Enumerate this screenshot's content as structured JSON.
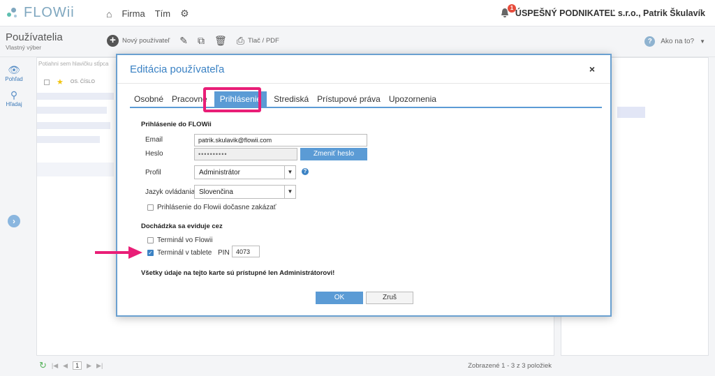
{
  "app": {
    "logo_text": "FLOWii"
  },
  "topnav": {
    "firma": "Firma",
    "tim": "Tím"
  },
  "company": {
    "name": "ÚSPEŠNÝ PODNIKATEĽ s.r.o., Patrik Škulavík",
    "notifications": "1"
  },
  "page": {
    "title": "Používatelia",
    "subtitle": "Vlastný výber"
  },
  "toolbar": {
    "new_user": "Nový používateľ",
    "print": "Tlač / PDF"
  },
  "help": {
    "label": "Ako na to?"
  },
  "sidebar": {
    "view": "Pohľad",
    "search": "Hľadaj"
  },
  "grid": {
    "group_hint": "Potiahni sem hlavičku stĺpca",
    "col_number": "OS. ČÍSLO"
  },
  "footer": {
    "page": "1",
    "count": "Zobrazené 1 - 3 z 3 položiek"
  },
  "modal": {
    "title": "Editácia používateľa",
    "close": "×",
    "tabs": [
      "Osobné",
      "Pracovné",
      "Prihlásenie",
      "Strediská",
      "Prístupové práva",
      "Upozornenia"
    ],
    "login_section": "Prihlásenie do FLOWii",
    "email_label": "Email",
    "email_value": "patrik.skulavik@flowii.com",
    "password_label": "Heslo",
    "password_value": "••••••••••",
    "change_password": "Zmeniť heslo",
    "profile_label": "Profil",
    "profile_value": "Administrátor",
    "language_label": "Jazyk ovládania",
    "language_value": "Slovenčina",
    "disable_login": "Prihlásenie do Flowii dočasne zakázať",
    "attendance_section": "Dochádzka sa eviduje cez",
    "terminal_flowii": "Terminál vo Flowii",
    "terminal_tablet": "Terminál v tablete",
    "pin_label": "PIN",
    "pin_value": "4073",
    "admin_note": "Všetky údaje na tejto karte sú prístupné len Administrátorovi!",
    "ok": "OK",
    "cancel": "Zruš"
  },
  "colors": {
    "accent": "#5b9bd5",
    "highlight": "#e91e77",
    "title": "#3b82c4"
  }
}
